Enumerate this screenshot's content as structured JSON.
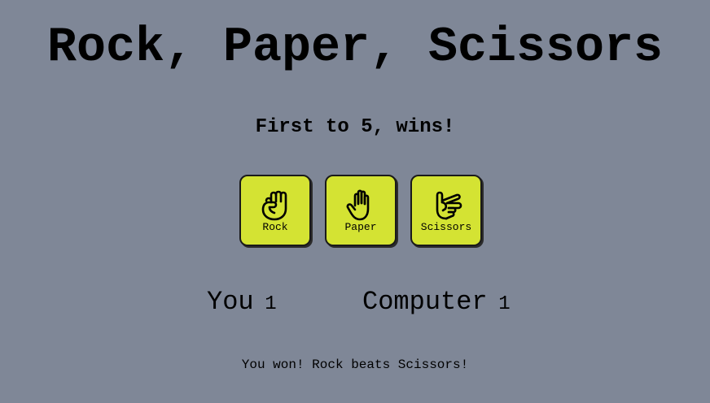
{
  "title": "Rock, Paper, Scissors",
  "subtitle": "First to 5, wins!",
  "choices": [
    {
      "label": "Rock",
      "icon": "fist-icon"
    },
    {
      "label": "Paper",
      "icon": "open-hand-icon"
    },
    {
      "label": "Scissors",
      "icon": "scissors-hand-icon"
    }
  ],
  "score": {
    "player_label": "You",
    "player_value": "1",
    "computer_label": "Computer",
    "computer_value": "1"
  },
  "result_message": "You won! Rock beats Scissors!",
  "colors": {
    "background": "#7f8797",
    "button": "#d4e333"
  }
}
